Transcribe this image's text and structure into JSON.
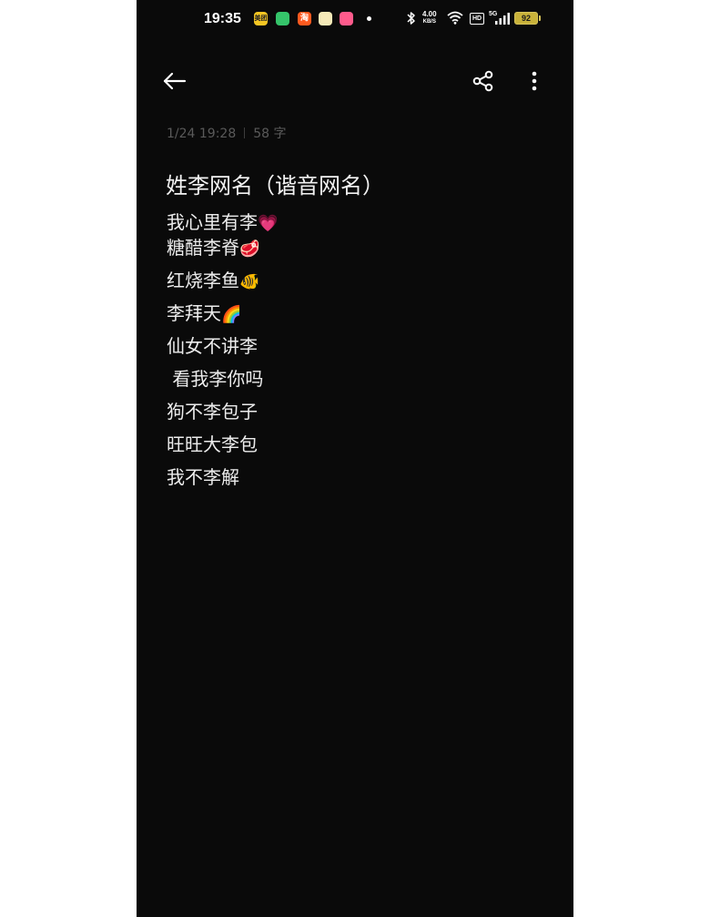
{
  "status_bar": {
    "time": "19:35",
    "notification_apps": [
      {
        "name": "meituan-icon",
        "label": "美团",
        "color": "#f5c623"
      },
      {
        "name": "wechat-mini-icon",
        "label": "",
        "color": "#35c46a"
      },
      {
        "name": "taobao-icon",
        "label": "淘",
        "color": "#ff5a1f"
      },
      {
        "name": "notes-app-icon",
        "label": "",
        "color": "#f5e9b8"
      },
      {
        "name": "pink-app-icon",
        "label": "",
        "color": "#ff5b8c"
      }
    ],
    "net_speed_value": "4.00",
    "net_speed_unit": "KB/S",
    "hd_label": "HD",
    "signal_label": "5G",
    "battery_level": "92"
  },
  "toolbar": {
    "back_icon": "arrow-left-icon",
    "share_icon": "share-icon",
    "more_icon": "more-vertical-icon"
  },
  "note": {
    "date": "1/24 19:28",
    "word_count": "58 字",
    "title": "姓李网名（谐音网名）",
    "lines": [
      {
        "text": "我心里有李",
        "emoji": "💗"
      },
      {
        "text": "糖醋李脊",
        "emoji": "🥩"
      },
      {
        "text": "红烧李鱼",
        "emoji": "🐠"
      },
      {
        "text": "李拜天",
        "emoji": "🌈"
      },
      {
        "text": "仙女不讲李",
        "emoji": ""
      },
      {
        "text": " 看我李你吗",
        "emoji": ""
      },
      {
        "text": "狗不李包子",
        "emoji": ""
      },
      {
        "text": "旺旺大李包",
        "emoji": ""
      },
      {
        "text": "我不李解",
        "emoji": ""
      }
    ]
  }
}
